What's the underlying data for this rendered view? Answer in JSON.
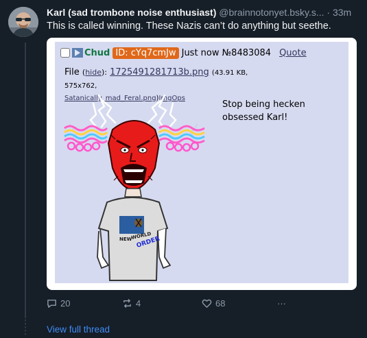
{
  "post": {
    "author_display_name": "Karl (sad trombone noise enthusiast)",
    "author_handle": "@brainnotonyet.bsky.s...",
    "separator": "·",
    "time": "33m",
    "text": "This is called winning. These Nazis can’t do anything but seethe."
  },
  "embed": {
    "poster_name": "Chud",
    "id_label": "ID: cYq7cmJw",
    "timestamp": "Just now",
    "post_number": "№8483084",
    "quote_label": "Quote",
    "file_label": "File",
    "hide_label": "hide",
    "file_name": "1725491281713b.png",
    "file_meta": "(43.91 KB, 575x762,",
    "original_name": "Satanically_mad_Feral.png",
    "imgops_label": "ImgOps",
    "comment": "Stop being hecken obsessed Karl!"
  },
  "meme_texts": {
    "shirt_text_1": "NEW",
    "shirt_text_2": "WORLD",
    "shirt_text_3": "ORDER"
  },
  "actions": {
    "replies": "20",
    "reposts": "4",
    "likes": "68",
    "more": "···"
  },
  "view_full_thread": "View full thread",
  "colors": {
    "background": "#161e27",
    "link": "#3f8cf6",
    "chan_background": "#d6daf0",
    "chud_name": "#117743",
    "id_tag": "#e0681a"
  }
}
